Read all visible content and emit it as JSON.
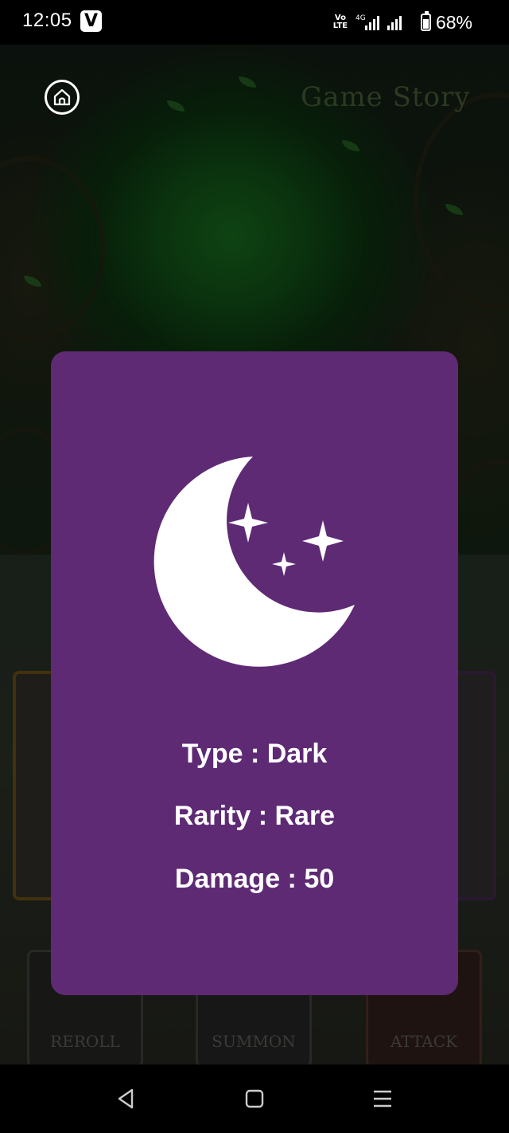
{
  "status_bar": {
    "time": "12:05",
    "app_badge": "V",
    "network_label": "VoLTE",
    "network_type": "4G",
    "battery_percent": "68%",
    "battery_level": 0.68
  },
  "game": {
    "title": "Game Story",
    "buttons": {
      "reroll": "REROLL",
      "summon": "SUMMON",
      "attack": "ATTACK"
    }
  },
  "card": {
    "icon": "moon-stars-icon",
    "background_color": "#5e2a74",
    "type_line": "Type : Dark",
    "rarity_line": "Rarity : Rare",
    "damage_line": "Damage : 50"
  },
  "navigation": {
    "back": "back-icon",
    "home": "home-square-icon",
    "menu": "menu-icon"
  }
}
